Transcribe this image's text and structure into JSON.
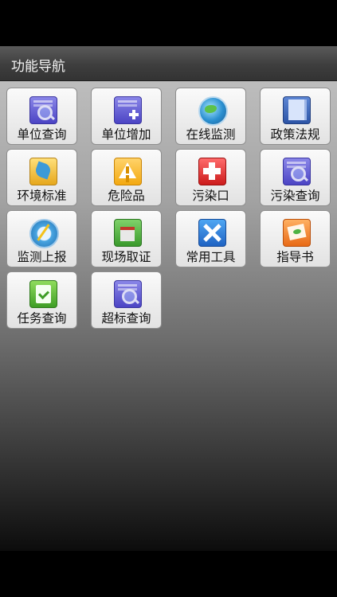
{
  "header": {
    "title": "功能导航"
  },
  "tiles": [
    {
      "label": "单位查询",
      "icon": "document-search-icon"
    },
    {
      "label": "单位增加",
      "icon": "document-add-icon"
    },
    {
      "label": "在线监测",
      "icon": "globe-icon"
    },
    {
      "label": "政策法规",
      "icon": "book-icon"
    },
    {
      "label": "环境标准",
      "icon": "plug-icon"
    },
    {
      "label": "危险品",
      "icon": "warning-icon"
    },
    {
      "label": "污染口",
      "icon": "red-cross-icon"
    },
    {
      "label": "污染查询",
      "icon": "document-search-icon"
    },
    {
      "label": "监测上报",
      "icon": "compass-icon"
    },
    {
      "label": "现场取证",
      "icon": "scene-icon"
    },
    {
      "label": "常用工具",
      "icon": "tools-icon"
    },
    {
      "label": "指导书",
      "icon": "guide-book-icon"
    },
    {
      "label": "任务查询",
      "icon": "task-icon"
    },
    {
      "label": "超标查询",
      "icon": "document-search-icon"
    }
  ]
}
